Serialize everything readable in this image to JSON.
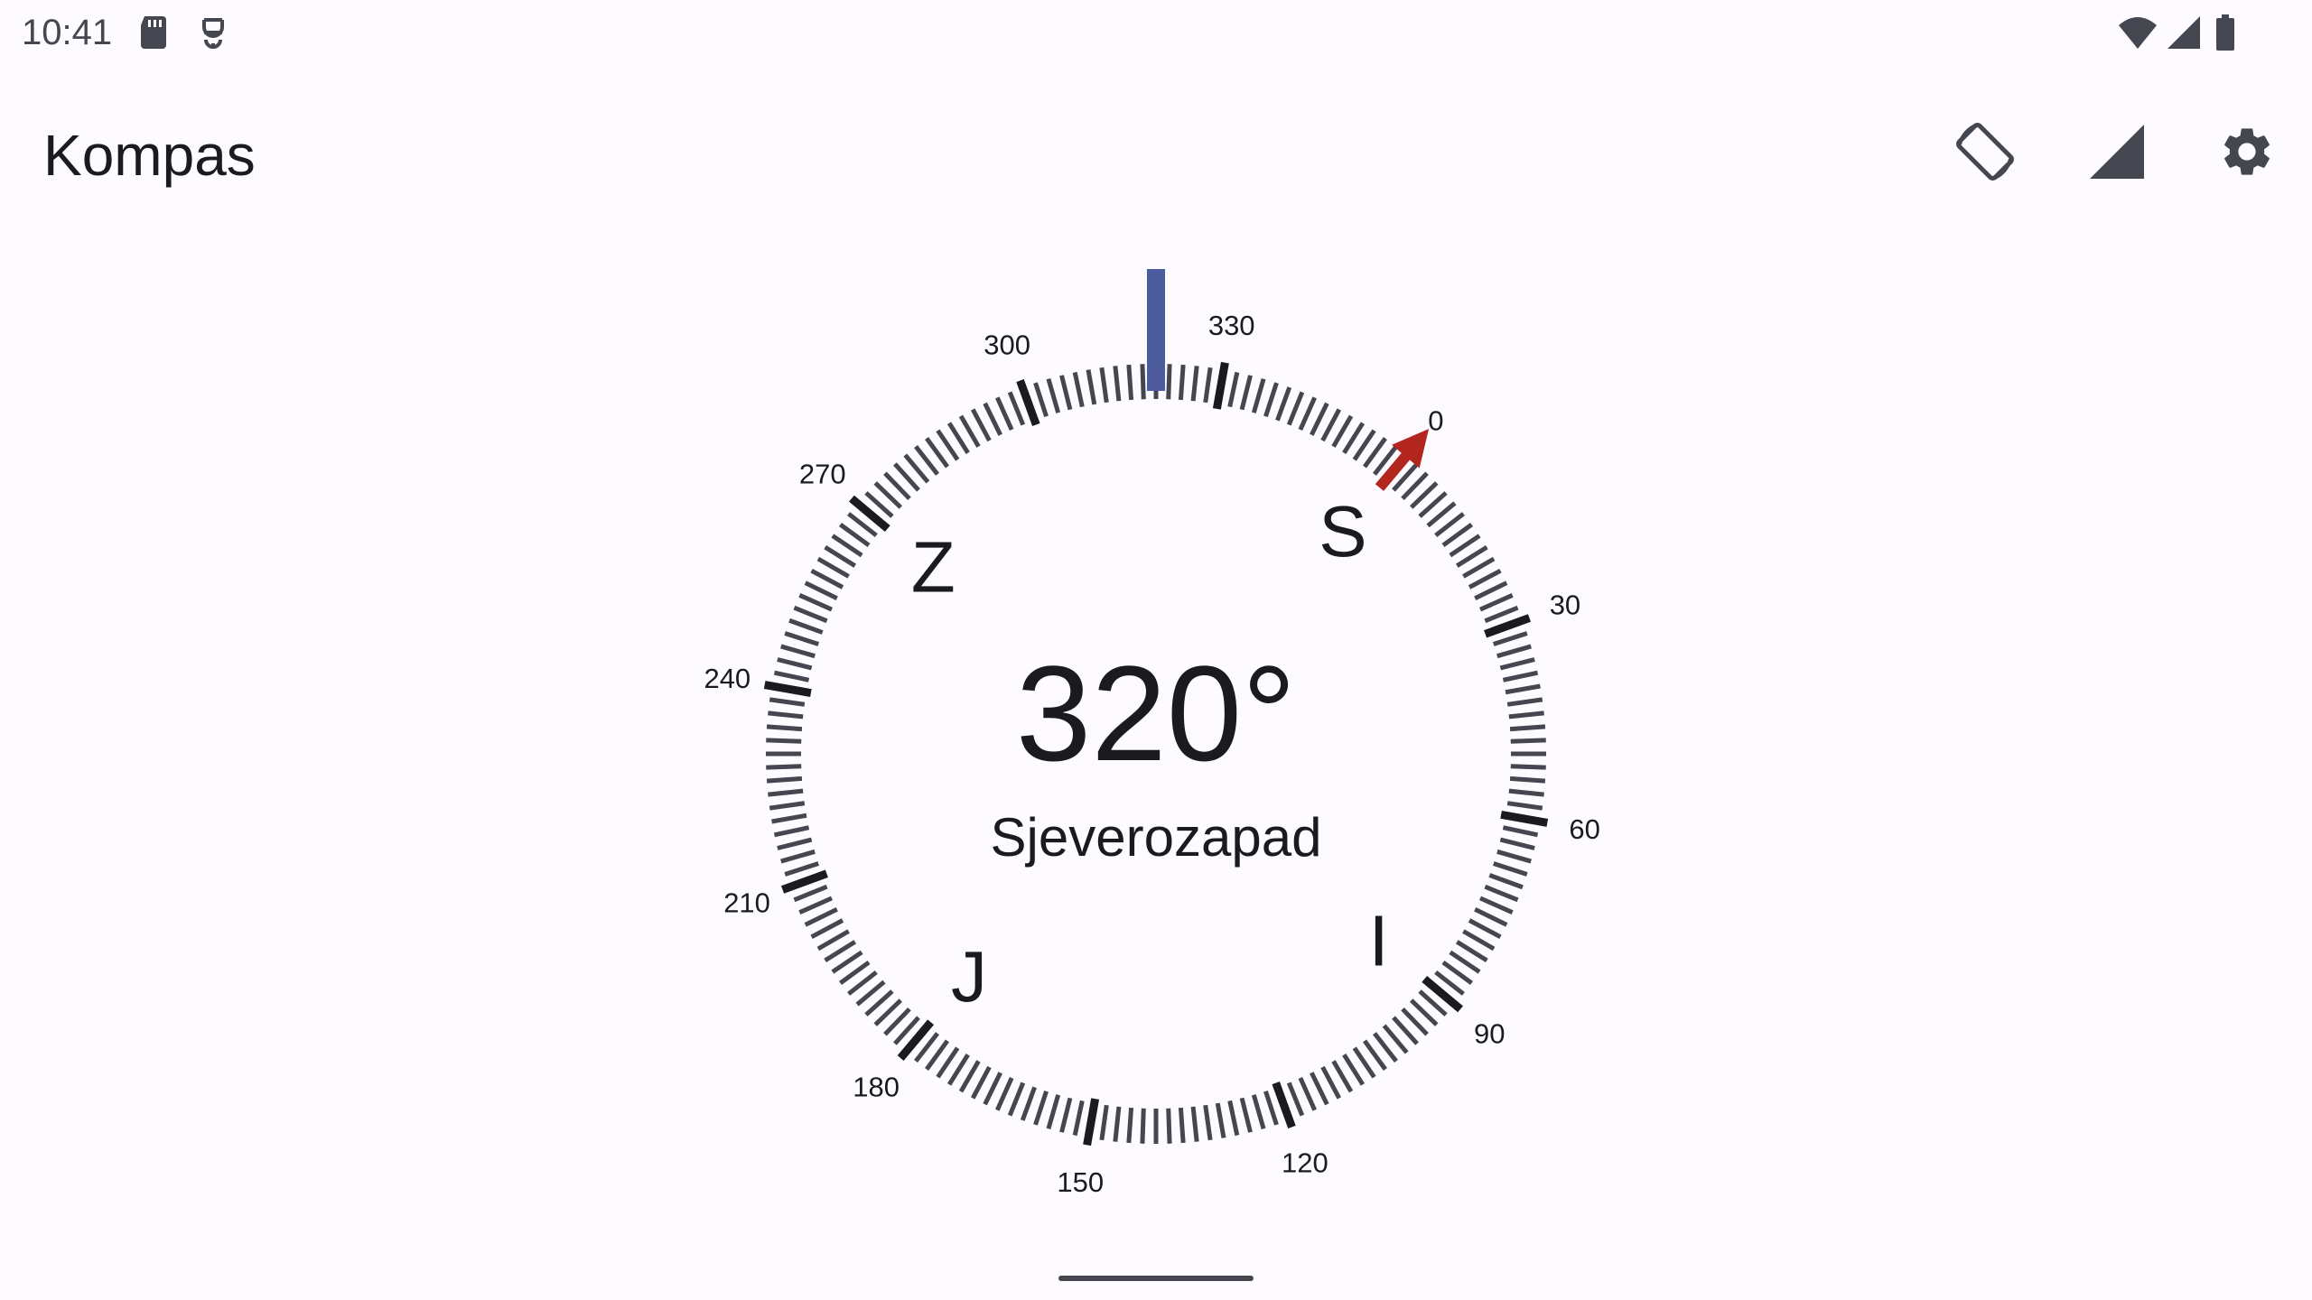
{
  "status_bar": {
    "time": "10:41",
    "icons_left": [
      "sd-card-icon",
      "app-notification-icon"
    ],
    "icons_right": [
      "wifi-icon",
      "cellular-signal-icon",
      "battery-icon"
    ]
  },
  "app_bar": {
    "title": "Kompas",
    "actions": [
      {
        "name": "screen-rotation-button",
        "icon": "screen-rotation-icon"
      },
      {
        "name": "signal-strength-button",
        "icon": "signal-strength-icon"
      },
      {
        "name": "settings-button",
        "icon": "gear-icon"
      }
    ]
  },
  "compass": {
    "heading_value": "320°",
    "heading_direction": "Sjeverozapad",
    "heading_degrees": 320,
    "cardinal_labels": [
      {
        "label": "S",
        "bearing": 0
      },
      {
        "label": "I",
        "bearing": 90
      },
      {
        "label": "J",
        "bearing": 180
      },
      {
        "label": "Z",
        "bearing": 270
      }
    ],
    "degree_labels": [
      "0",
      "30",
      "60",
      "90",
      "120",
      "150",
      "180",
      "210",
      "240",
      "270",
      "300",
      "330"
    ],
    "colors": {
      "heading_indicator": "#4c5b9b",
      "north_arrow": "#b3261e",
      "tick": "#45464f",
      "major_tick": "#1b1b1f"
    }
  }
}
